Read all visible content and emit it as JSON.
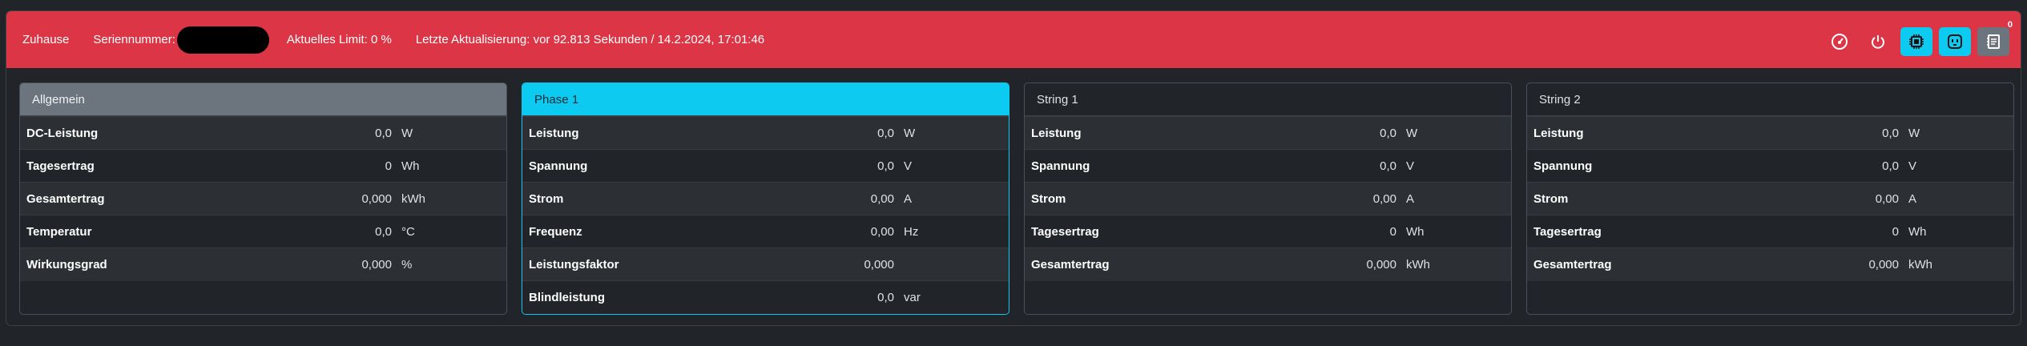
{
  "header": {
    "title": "Zuhause",
    "serial_label": "Seriennummer:",
    "limit": "Aktuelles Limit: 0 %",
    "last_update": "Letzte Aktualisierung: vor 92.813 Sekunden / 14.2.2024, 17:01:46",
    "notification_count": "0",
    "icons": [
      "speedometer-icon",
      "power-icon",
      "cpu-icon",
      "outlet-icon",
      "journal-icon"
    ],
    "color": "#dc3545"
  },
  "cards": {
    "general": {
      "title": "Allgemein",
      "rows": [
        {
          "label": "DC-Leistung",
          "value": "0,0",
          "unit": "W"
        },
        {
          "label": "Tagesertrag",
          "value": "0",
          "unit": "Wh"
        },
        {
          "label": "Gesamtertrag",
          "value": "0,000",
          "unit": "kWh"
        },
        {
          "label": "Temperatur",
          "value": "0,0",
          "unit": "°C"
        },
        {
          "label": "Wirkungsgrad",
          "value": "0,000",
          "unit": "%"
        }
      ]
    },
    "phase1": {
      "title": "Phase 1",
      "rows": [
        {
          "label": "Leistung",
          "value": "0,0",
          "unit": "W"
        },
        {
          "label": "Spannung",
          "value": "0,0",
          "unit": "V"
        },
        {
          "label": "Strom",
          "value": "0,00",
          "unit": "A"
        },
        {
          "label": "Frequenz",
          "value": "0,00",
          "unit": "Hz"
        },
        {
          "label": "Leistungsfaktor",
          "value": "0,000",
          "unit": ""
        },
        {
          "label": "Blindleistung",
          "value": "0,0",
          "unit": "var"
        }
      ]
    },
    "string1": {
      "title": "String 1",
      "rows": [
        {
          "label": "Leistung",
          "value": "0,0",
          "unit": "W"
        },
        {
          "label": "Spannung",
          "value": "0,0",
          "unit": "V"
        },
        {
          "label": "Strom",
          "value": "0,00",
          "unit": "A"
        },
        {
          "label": "Tagesertrag",
          "value": "0",
          "unit": "Wh"
        },
        {
          "label": "Gesamtertrag",
          "value": "0,000",
          "unit": "kWh"
        }
      ]
    },
    "string2": {
      "title": "String 2",
      "rows": [
        {
          "label": "Leistung",
          "value": "0,0",
          "unit": "W"
        },
        {
          "label": "Spannung",
          "value": "0,0",
          "unit": "V"
        },
        {
          "label": "Strom",
          "value": "0,00",
          "unit": "A"
        },
        {
          "label": "Tagesertrag",
          "value": "0",
          "unit": "Wh"
        },
        {
          "label": "Gesamtertrag",
          "value": "0,000",
          "unit": "kWh"
        }
      ]
    }
  }
}
